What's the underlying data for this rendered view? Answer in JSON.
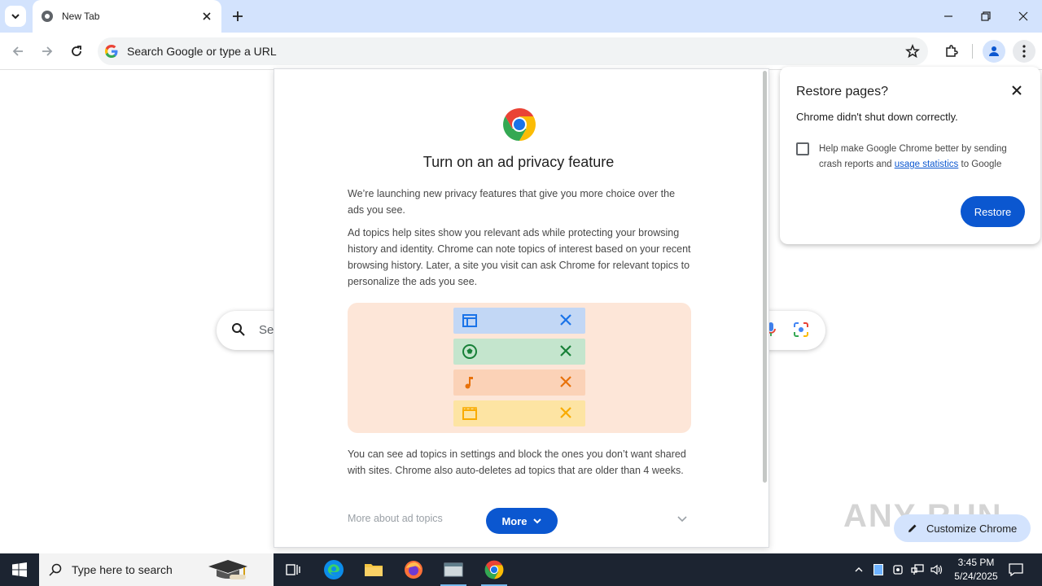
{
  "browser": {
    "tab_title": "New Tab",
    "omnibox_placeholder": "Search Google or type a URL",
    "ntp_search_placeholder": "Se"
  },
  "privacy_dialog": {
    "title": "Turn on an ad privacy feature",
    "paragraph1": "We’re launching new privacy features that give you more choice over the ads you see.",
    "paragraph2": "Ad topics help sites show you relevant ads while protecting your browsing history and identity. Chrome can note topics of interest based on your recent browsing history. Later, a site you visit can ask Chrome for relevant topics to personalize the ads you see.",
    "paragraph3": "You can see ad topics in settings and block the ones you don’t want shared with sites. Chrome also auto-deletes ad topics that are older than 4 weeks.",
    "more_link": "More about ad topics",
    "more_button": "More",
    "topics": [
      {
        "icon": "newspaper-icon",
        "color": "#1a73e8",
        "bg": "#c2d7f5"
      },
      {
        "icon": "soccer-ball-icon",
        "color": "#188038",
        "bg": "#c4e5cd"
      },
      {
        "icon": "music-note-icon",
        "color": "#e8710a",
        "bg": "#fbd2b7"
      },
      {
        "icon": "clapperboard-icon",
        "color": "#f9ab00",
        "bg": "#fde4a3"
      }
    ]
  },
  "restore_bubble": {
    "title": "Restore pages?",
    "message": "Chrome didn't shut down correctly.",
    "help_prefix": "Help make Google Chrome better by sending crash reports and ",
    "help_link": "usage statistics",
    "help_suffix": " to Google",
    "restore_button": "Restore"
  },
  "customize_button": "Customize Chrome",
  "watermark": "ANY RUN",
  "taskbar": {
    "search_placeholder": "Type here to search",
    "time": "3:45 PM",
    "date": "5/24/2025"
  },
  "colors": {
    "tabstrip": "#d3e3fd",
    "accent": "#0b57d0",
    "taskbar": "#1c2431"
  }
}
